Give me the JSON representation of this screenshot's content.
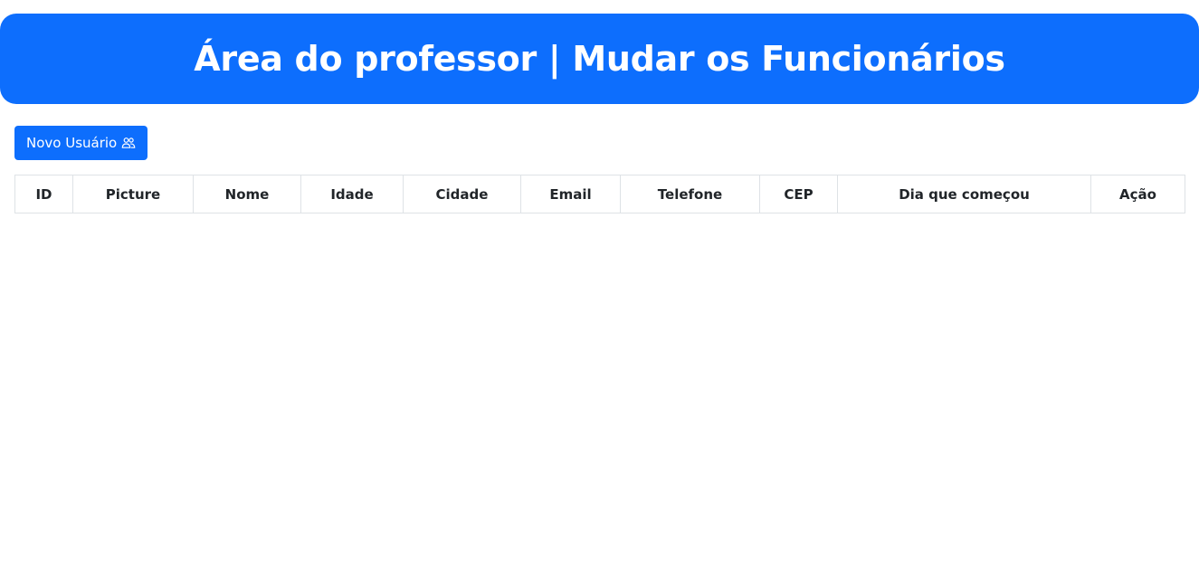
{
  "header": {
    "title": "Área do professor | Mudar os Funcionários"
  },
  "toolbar": {
    "new_user_label": "Novo Usuário",
    "new_user_icon": "people-icon"
  },
  "table": {
    "columns": [
      "ID",
      "Picture",
      "Nome",
      "Idade",
      "Cidade",
      "Email",
      "Telefone",
      "CEP",
      "Dia que começou",
      "Ação"
    ],
    "rows": []
  },
  "colors": {
    "primary": "#0d6efd",
    "border": "#dee2e6",
    "text": "#212529"
  }
}
